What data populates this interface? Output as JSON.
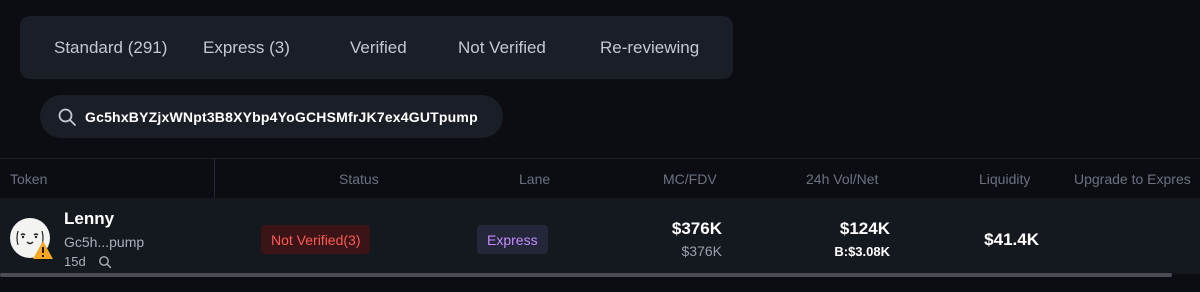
{
  "tabs": [
    {
      "label": "Standard (291)"
    },
    {
      "label": "Express (3)"
    },
    {
      "label": "Verified"
    },
    {
      "label": "Not Verified"
    },
    {
      "label": "Re-reviewing"
    }
  ],
  "search": {
    "value": "Gc5hxBYZjxWNpt3B8XYbp4YoGCHSMfrJK7ex4GUTpump",
    "icon": "search-icon"
  },
  "table": {
    "headers": {
      "token": "Token",
      "status": "Status",
      "lane": "Lane",
      "mc_fdv": "MC/FDV",
      "vol_net": "24h Vol/Net",
      "liquidity": "Liquidity",
      "upgrade": "Upgrade to Expres"
    },
    "rows": [
      {
        "name": "Lenny",
        "address": "Gc5h...pump",
        "age": "15d",
        "status": "Not Verified(3)",
        "lane": "Express",
        "mc": "$376K",
        "fdv": "$376K",
        "vol": "$124K",
        "net": "B:$3.08K",
        "liquidity": "$41.4K"
      }
    ]
  },
  "colors": {
    "status_red": "#ff5a55",
    "lane_purple": "#c58bff",
    "warning_orange": "#f5a623"
  }
}
